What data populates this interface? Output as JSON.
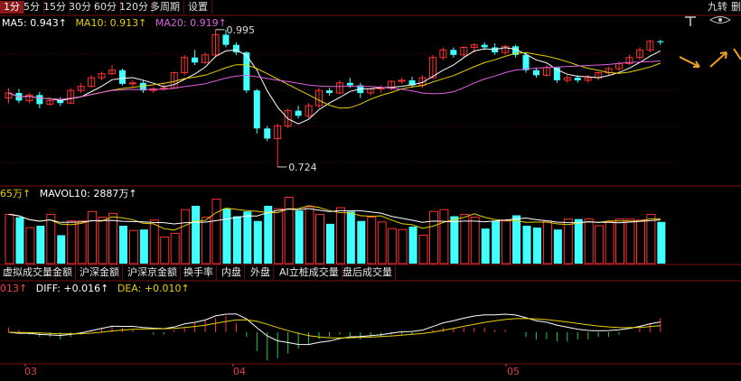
{
  "topbar": {
    "tabs": [
      "1分",
      "5分",
      "15分",
      "30分",
      "60分",
      "120分",
      "多周期",
      "设置"
    ],
    "active_tab": 0,
    "right_labels": [
      "九转",
      "删"
    ]
  },
  "ma_legend": {
    "ma5": {
      "label": "MA5: 0.943↑",
      "color": "#ffffff"
    },
    "ma10": {
      "label": "MA10: 0.913↑",
      "color": "#e8d000"
    },
    "ma20": {
      "label": "MA20: 0.919↑",
      "color": "#e060e0"
    }
  },
  "vol_legend": {
    "vol": {
      "label": "65万↑",
      "color": "#e8d000"
    },
    "mavol10": {
      "label": "MAVOL10: 2887万↑",
      "color": "#ffffff"
    }
  },
  "subtabs": [
    "虚拟成交量",
    "金额",
    "沪深金额",
    "沪深京金额",
    "换手率",
    "内盘",
    "外盘",
    "AI立桩成交量",
    "盘后成交量"
  ],
  "macd_legend": {
    "macd": {
      "label": "013↑",
      "color": "#ff4040"
    },
    "diff": {
      "label": "DIFF: +0.016↑",
      "color": "#ffffff"
    },
    "dea": {
      "label": "DEA: +0.010↑",
      "color": "#e8d000"
    }
  },
  "annotations": {
    "high": "0.995",
    "low": "0.724"
  },
  "months": [
    "03",
    "04",
    "05"
  ],
  "colors": {
    "up": "#ff3030",
    "down": "#40ffff",
    "bg": "#000000",
    "grid": "#7a1010"
  },
  "candles": [
    [
      0.86,
      0.88,
      0.85,
      0.87
    ],
    [
      0.87,
      0.878,
      0.85,
      0.855
    ],
    [
      0.855,
      0.87,
      0.85,
      0.866
    ],
    [
      0.866,
      0.872,
      0.84,
      0.848
    ],
    [
      0.848,
      0.86,
      0.845,
      0.855
    ],
    [
      0.855,
      0.862,
      0.844,
      0.85
    ],
    [
      0.85,
      0.88,
      0.848,
      0.875
    ],
    [
      0.875,
      0.89,
      0.87,
      0.883
    ],
    [
      0.883,
      0.905,
      0.88,
      0.9
    ],
    [
      0.9,
      0.912,
      0.895,
      0.908
    ],
    [
      0.908,
      0.925,
      0.905,
      0.915
    ],
    [
      0.915,
      0.918,
      0.885,
      0.888
    ],
    [
      0.888,
      0.895,
      0.88,
      0.89
    ],
    [
      0.89,
      0.895,
      0.87,
      0.875
    ],
    [
      0.875,
      0.882,
      0.87,
      0.878
    ],
    [
      0.878,
      0.89,
      0.875,
      0.88
    ],
    [
      0.88,
      0.912,
      0.878,
      0.91
    ],
    [
      0.91,
      0.945,
      0.905,
      0.94
    ],
    [
      0.94,
      0.955,
      0.925,
      0.93
    ],
    [
      0.93,
      0.95,
      0.928,
      0.945
    ],
    [
      0.945,
      0.995,
      0.94,
      0.985
    ],
    [
      0.985,
      0.995,
      0.96,
      0.965
    ],
    [
      0.965,
      0.97,
      0.945,
      0.95
    ],
    [
      0.95,
      0.952,
      0.87,
      0.875
    ],
    [
      0.875,
      0.878,
      0.79,
      0.8
    ],
    [
      0.8,
      0.805,
      0.775,
      0.78
    ],
    [
      0.78,
      0.81,
      0.724,
      0.805
    ],
    [
      0.805,
      0.84,
      0.8,
      0.835
    ],
    [
      0.835,
      0.845,
      0.82,
      0.825
    ],
    [
      0.825,
      0.85,
      0.82,
      0.845
    ],
    [
      0.845,
      0.88,
      0.84,
      0.875
    ],
    [
      0.875,
      0.88,
      0.865,
      0.87
    ],
    [
      0.87,
      0.895,
      0.868,
      0.89
    ],
    [
      0.89,
      0.9,
      0.88,
      0.885
    ],
    [
      0.885,
      0.89,
      0.86,
      0.87
    ],
    [
      0.87,
      0.88,
      0.865,
      0.878
    ],
    [
      0.878,
      0.885,
      0.87,
      0.88
    ],
    [
      0.88,
      0.895,
      0.875,
      0.893
    ],
    [
      0.893,
      0.9,
      0.888,
      0.895
    ],
    [
      0.895,
      0.902,
      0.88,
      0.885
    ],
    [
      0.885,
      0.905,
      0.88,
      0.9
    ],
    [
      0.9,
      0.945,
      0.898,
      0.94
    ],
    [
      0.94,
      0.96,
      0.935,
      0.955
    ],
    [
      0.955,
      0.96,
      0.94,
      0.945
    ],
    [
      0.945,
      0.962,
      0.94,
      0.96
    ],
    [
      0.96,
      0.968,
      0.95,
      0.965
    ],
    [
      0.965,
      0.97,
      0.955,
      0.96
    ],
    [
      0.96,
      0.968,
      0.945,
      0.95
    ],
    [
      0.95,
      0.965,
      0.945,
      0.962
    ],
    [
      0.962,
      0.965,
      0.94,
      0.945
    ],
    [
      0.945,
      0.95,
      0.91,
      0.915
    ],
    [
      0.915,
      0.92,
      0.9,
      0.905
    ],
    [
      0.905,
      0.925,
      0.902,
      0.92
    ],
    [
      0.92,
      0.922,
      0.89,
      0.895
    ],
    [
      0.895,
      0.905,
      0.89,
      0.9
    ],
    [
      0.9,
      0.905,
      0.89,
      0.895
    ],
    [
      0.895,
      0.905,
      0.89,
      0.9
    ],
    [
      0.9,
      0.912,
      0.895,
      0.91
    ],
    [
      0.91,
      0.922,
      0.905,
      0.918
    ],
    [
      0.918,
      0.932,
      0.912,
      0.928
    ],
    [
      0.928,
      0.945,
      0.925,
      0.94
    ],
    [
      0.94,
      0.96,
      0.935,
      0.955
    ],
    [
      0.955,
      0.975,
      0.95,
      0.972
    ],
    [
      0.972,
      0.975,
      0.965,
      0.97
    ]
  ],
  "volumes": [
    52,
    49,
    38,
    40,
    52,
    30,
    45,
    45,
    55,
    49,
    53,
    40,
    35,
    36,
    46,
    28,
    32,
    57,
    61,
    49,
    68,
    58,
    50,
    55,
    45,
    61,
    58,
    70,
    56,
    60,
    52,
    42,
    59,
    55,
    45,
    49,
    44,
    37,
    36,
    39,
    30,
    55,
    57,
    50,
    52,
    49,
    37,
    45,
    45,
    51,
    40,
    38,
    45,
    36,
    47,
    47,
    47,
    40,
    44,
    47,
    47,
    46,
    52,
    44
  ],
  "macd_hist": [
    0.002,
    0.001,
    -0.001,
    -0.002,
    -0.002,
    -0.003,
    -0.002,
    -0.001,
    0.001,
    0.002,
    0.003,
    0.002,
    0.001,
    0.0,
    -0.001,
    -0.001,
    0.001,
    0.002,
    0.004,
    0.005,
    0.006,
    0.007,
    0.004,
    -0.002,
    -0.008,
    -0.012,
    -0.011,
    -0.009,
    -0.007,
    -0.005,
    -0.003,
    -0.002,
    -0.001,
    -0.002,
    -0.003,
    -0.002,
    -0.002,
    -0.001,
    -0.001,
    -0.001,
    0.0,
    0.001,
    0.002,
    0.002,
    0.002,
    0.002,
    0.002,
    0.001,
    0.001,
    0.0,
    -0.002,
    -0.003,
    -0.003,
    -0.004,
    -0.004,
    -0.003,
    -0.003,
    -0.002,
    -0.002,
    -0.001,
    0.0,
    0.002,
    0.004,
    0.006
  ]
}
